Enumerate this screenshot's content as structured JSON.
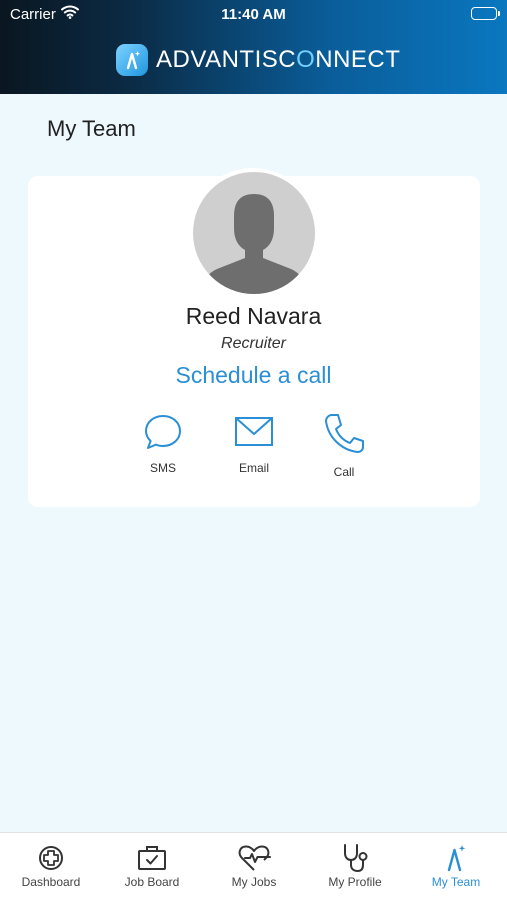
{
  "status_bar": {
    "carrier": "Carrier",
    "time": "11:40 AM"
  },
  "header": {
    "brand_primary": "ADVANTISC",
    "brand_o": "O",
    "brand_rest": "NNECT"
  },
  "page": {
    "title": "My Team"
  },
  "member": {
    "name": "Reed Navara",
    "role": "Recruiter",
    "schedule_label": "Schedule a call"
  },
  "contacts": [
    {
      "label": "SMS",
      "icon": "chat-bubble-icon"
    },
    {
      "label": "Email",
      "icon": "envelope-icon"
    },
    {
      "label": "Call",
      "icon": "phone-icon"
    }
  ],
  "tabs": [
    {
      "label": "Dashboard",
      "icon": "plus-circle-icon"
    },
    {
      "label": "Job Board",
      "icon": "briefcase-check-icon"
    },
    {
      "label": "My Jobs",
      "icon": "heart-pulse-icon"
    },
    {
      "label": "My Profile",
      "icon": "stethoscope-icon"
    },
    {
      "label": "My Team",
      "icon": "sparkle-a-icon",
      "active": true
    }
  ],
  "colors": {
    "accent": "#2b8fd6",
    "background": "#eef9fd",
    "header_dark": "#0a1620",
    "header_blue": "#0a77c0"
  }
}
